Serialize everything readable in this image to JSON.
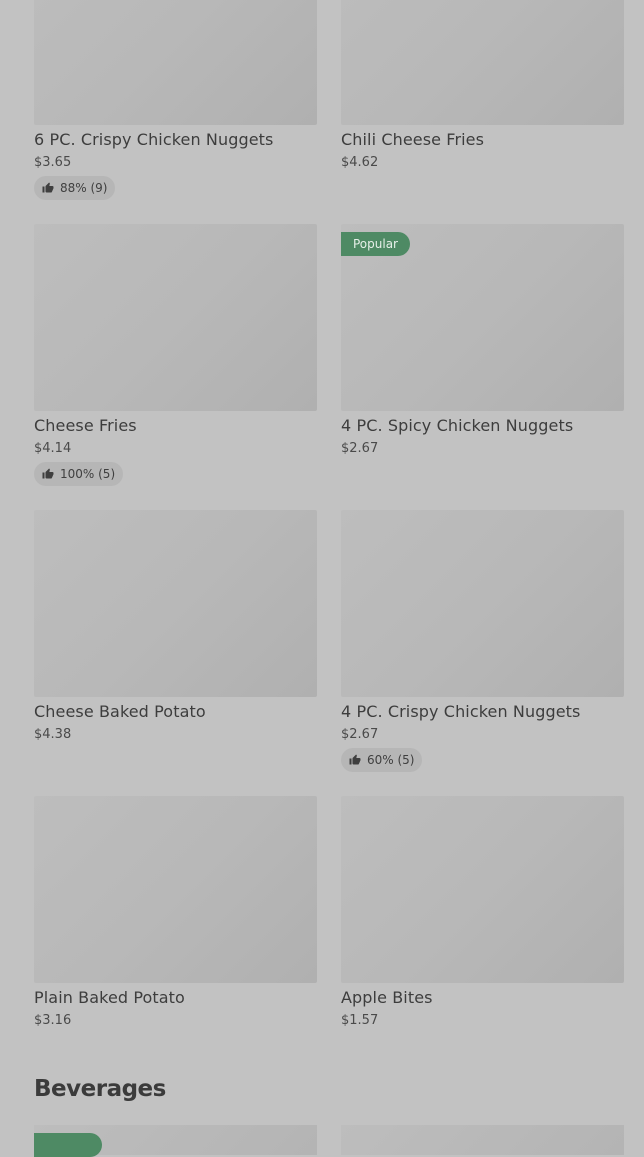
{
  "items": [
    {
      "name": "6 PC. Crispy Chicken Nuggets",
      "price": "$3.65",
      "rating": "88% (9)"
    },
    {
      "name": "Chili Cheese Fries",
      "price": "$4.62"
    },
    {
      "name": "Cheese Fries",
      "price": "$4.14",
      "rating": "100% (5)"
    },
    {
      "name": "4 PC. Spicy Chicken Nuggets",
      "price": "$2.67",
      "badge": "Popular"
    },
    {
      "name": "Cheese Baked Potato",
      "price": "$4.38"
    },
    {
      "name": "4 PC. Crispy Chicken Nuggets",
      "price": "$2.67",
      "rating": "60% (5)"
    },
    {
      "name": "Plain Baked Potato",
      "price": "$3.16"
    },
    {
      "name": "Apple Bites",
      "price": "$1.57"
    }
  ],
  "beverages": {
    "title": "Beverages"
  },
  "colors": {
    "badge": "#4e8a64",
    "background": "#c2c2c2"
  },
  "icons": {
    "rating": "thumbs-up-icon"
  }
}
